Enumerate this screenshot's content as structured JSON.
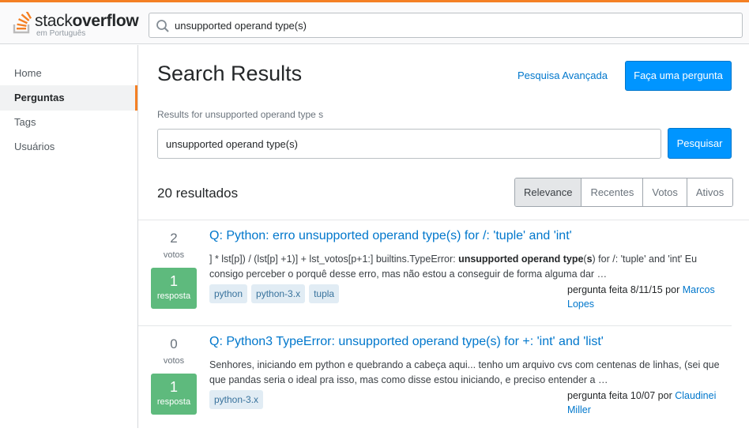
{
  "header": {
    "logo_main": "stack",
    "logo_bold": "overflow",
    "logo_sub": "em Português",
    "search_value": "unsupported operand type(s)",
    "brand_color": "#f48024"
  },
  "sidebar": {
    "items": [
      {
        "label": "Home"
      },
      {
        "label": "Perguntas"
      },
      {
        "label": "Tags"
      },
      {
        "label": "Usuários"
      }
    ],
    "active": "Perguntas"
  },
  "main": {
    "title": "Search Results",
    "advanced_link": "Pesquisa Avançada",
    "ask_button": "Faça uma pergunta",
    "results_for": "Results for unsupported operand type s",
    "search_value": "unsupported operand type(s)",
    "search_button": "Pesquisar",
    "count": "20 resultados",
    "sort_tabs": [
      "Relevance",
      "Recentes",
      "Votos",
      "Ativos"
    ],
    "sort_active": "Relevance"
  },
  "results": [
    {
      "votes": "2",
      "votes_label": "votos",
      "answers": "1",
      "answers_label": "resposta",
      "title": "Q: Python: erro unsupported operand type(s) for /: 'tuple' and 'int'",
      "excerpt_pre": "] * lst[p]) / (lst[p] +1)] + lst_votos[p+1:] builtins.TypeError: ",
      "excerpt_bold1": "unsupported operand type",
      "excerpt_mid": "(",
      "excerpt_bold2": "s",
      "excerpt_post": ") for /: 'tuple' and 'int' Eu consigo perceber o porquê desse erro, mas não estou a conseguir de forma alguma dar …",
      "tags": [
        "python",
        "python-3.x",
        "tupla"
      ],
      "asked": "pergunta feita 8/11/15 por",
      "author": "Marcos Lopes"
    },
    {
      "votes": "0",
      "votes_label": "votos",
      "answers": "1",
      "answers_label": "resposta",
      "title": "Q: Python3 TypeError: unsupported operand type(s) for +: 'int' and 'list'",
      "excerpt": "Senhores, iniciando em python e quebrando a cabeça aqui... tenho um arquivo cvs com centenas de linhas, (sei que que pandas seria o ideal pra isso, mas como disse estou iniciando, e preciso entender a …",
      "tags": [
        "python-3.x"
      ],
      "asked": "pergunta feita 10/07 por",
      "author": "Claudinei Miller"
    }
  ]
}
